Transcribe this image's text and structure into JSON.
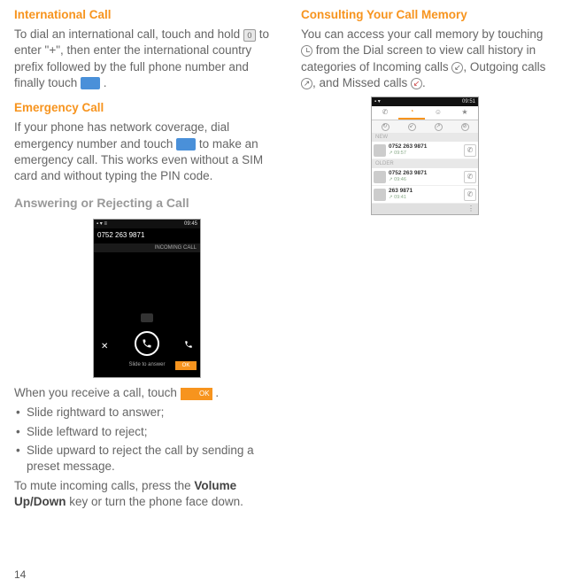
{
  "page_number": "14",
  "left": {
    "intl_heading": "International Call",
    "intl_p1a": "To dial an international call, touch and hold ",
    "intl_p1b": " to enter \"+\", then enter the international country prefix followed by the full phone number and finally touch ",
    "intl_p1c": " .",
    "icon_zero": "0",
    "emerg_heading": "Emergency Call",
    "emerg_p1a": "If your phone has network coverage, dial emergency number and touch ",
    "emerg_p1b": " to make an emergency call. This works even without a SIM card and without typing the PIN code.",
    "answer_heading": "Answering or Rejecting a Call",
    "phone1": {
      "time": "09:45",
      "number": "0752 263 9871",
      "incoming": "INCOMING CALL",
      "slide": "Slide to answer",
      "ok": "OK"
    },
    "receive_a": "When you receive a call, touch ",
    "receive_b": " .",
    "ok_label": "OK",
    "bullets": [
      "Slide rightward to answer;",
      "Slide leftward to reject;",
      "Slide upward to reject the call by sending a preset message."
    ],
    "mute_a": "To mute incoming calls, press the ",
    "mute_b": "Volume Up/Down",
    "mute_c": " key or turn the phone face down."
  },
  "right": {
    "heading": "Consulting Your Call Memory",
    "p1a": "You can access your call memory by touching ",
    "p1b": " from the Dial screen to view call history in categories of Incoming calls ",
    "p1c": ", Outgoing calls ",
    "p1d": ", and Missed calls ",
    "p1e": ".",
    "arrow_in": "↙",
    "arrow_out": "↗",
    "arrow_miss": "↙",
    "phone2": {
      "time": "09:51",
      "sec_new": "NEW",
      "sec_older": "OLDER",
      "rows": [
        {
          "name": "0752 263 9871",
          "time": "09:57"
        },
        {
          "name": "0752 263 9871",
          "time": "09:46"
        },
        {
          "name": "263 9871",
          "time": "09:41"
        }
      ]
    }
  }
}
